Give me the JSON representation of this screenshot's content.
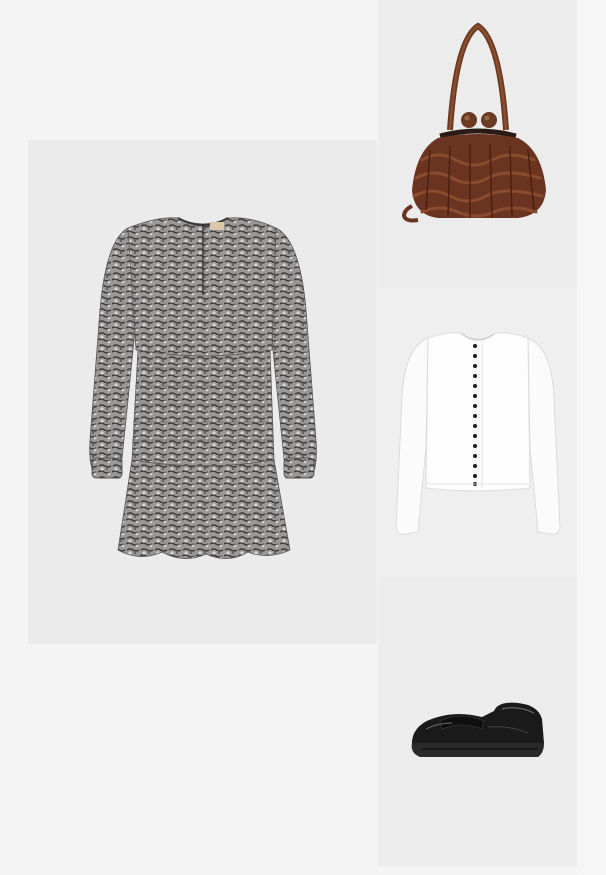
{
  "outfit": {
    "items": [
      {
        "id": "dress",
        "label": "",
        "icon": "snake-print-dress-image",
        "background": "#ebebeb"
      },
      {
        "id": "bag",
        "label": "",
        "icon": "woven-brown-handbag-image",
        "background": "#ececec"
      },
      {
        "id": "cardigan",
        "label": "",
        "icon": "white-button-cardigan-image",
        "background": "#efefef"
      },
      {
        "id": "loafer",
        "label": "",
        "icon": "black-penny-loafer-image",
        "background": "#ececec"
      }
    ]
  },
  "colors": {
    "page_background": "#f4f4f4",
    "bag_brown": "#6b3420",
    "dress_grey": "#8d8b8b",
    "cardigan_white": "#fbfbfb",
    "loafer_black": "#1a1a1a"
  }
}
